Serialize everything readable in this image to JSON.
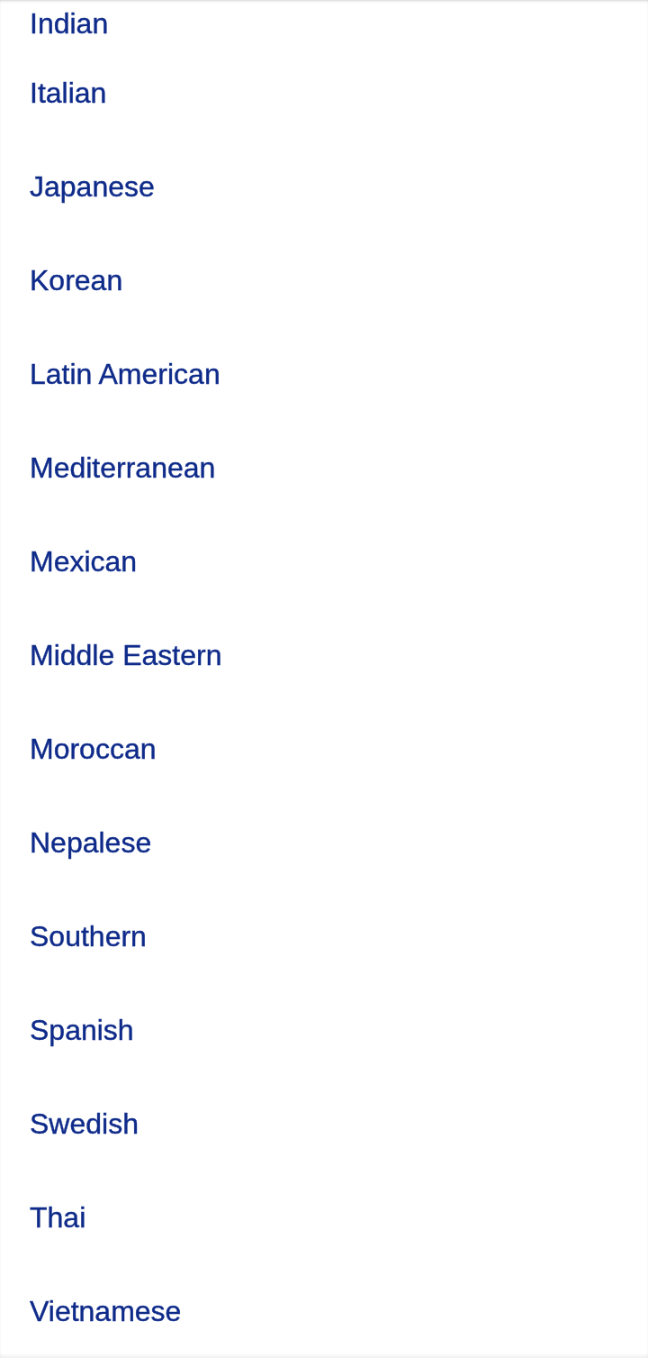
{
  "cuisine_list": {
    "items": [
      "Indian",
      "Italian",
      "Japanese",
      "Korean",
      "Latin American",
      "Mediterranean",
      "Mexican",
      "Middle Eastern",
      "Moroccan",
      "Nepalese",
      "Southern",
      "Spanish",
      "Swedish",
      "Thai",
      "Vietnamese"
    ]
  }
}
